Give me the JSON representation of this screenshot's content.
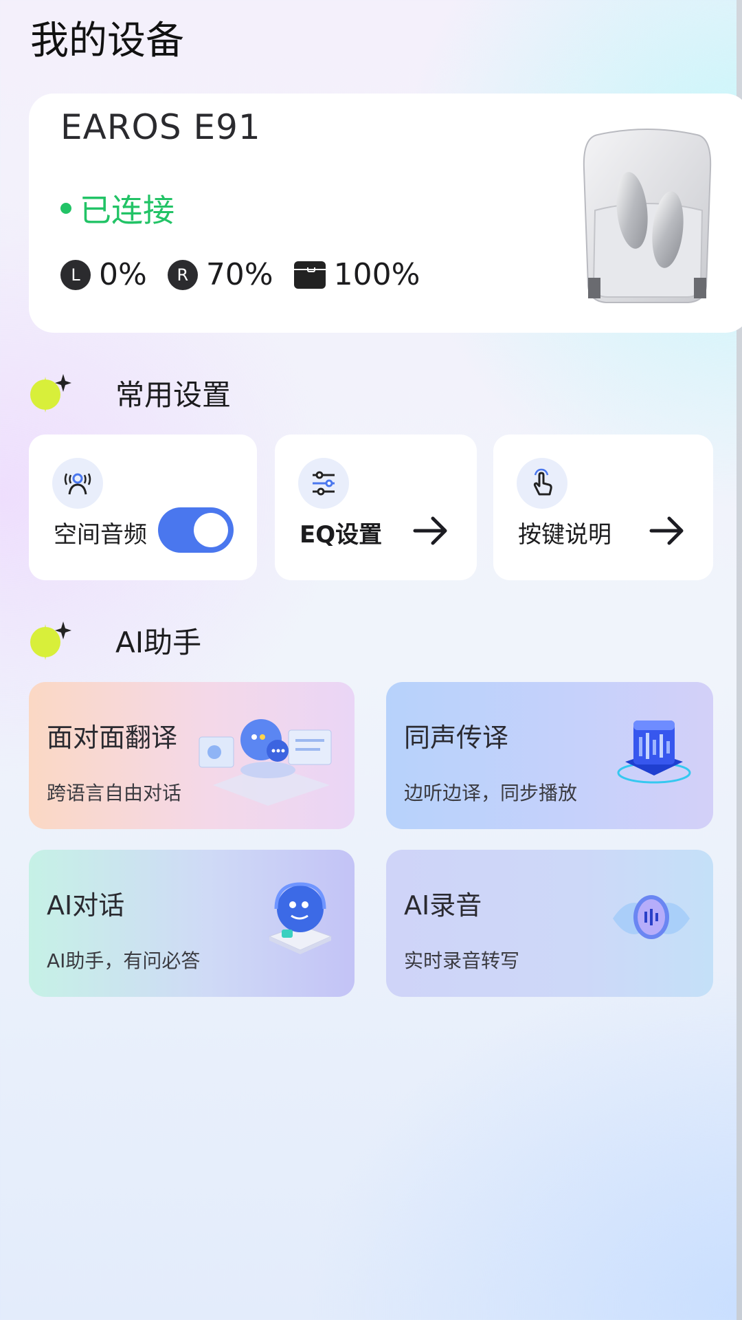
{
  "page_title": "我的设备",
  "device": {
    "name": "EAROS E91",
    "status": "已连接",
    "status_color": "#22c366",
    "battery": {
      "left_badge": "L",
      "left": "0%",
      "right_badge": "R",
      "right": "70%",
      "case": "100%"
    }
  },
  "settings_section": {
    "title": "常用设置",
    "spatial_audio": {
      "label": "空间音频",
      "enabled": true
    },
    "eq": {
      "label": "EQ设置"
    },
    "keys": {
      "label": "按键说明"
    }
  },
  "ai_section": {
    "title": "AI助手",
    "cards": [
      {
        "title": "面对面翻译",
        "subtitle": "跨语言自由对话"
      },
      {
        "title": "同声传译",
        "subtitle": "边听边译，同步播放"
      },
      {
        "title": "AI对话",
        "subtitle": "AI助手，有问必答"
      },
      {
        "title": "AI录音",
        "subtitle": "实时录音转写"
      }
    ]
  },
  "colors": {
    "accent": "#4a77ee",
    "spark": "#d8ef3a"
  }
}
